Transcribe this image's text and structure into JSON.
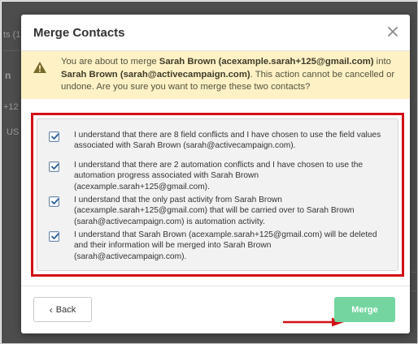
{
  "background": {
    "fragments": [
      "ts (1",
      "n",
      "+12",
      "US"
    ]
  },
  "modal": {
    "title": "Merge Contacts",
    "warning": {
      "prefix": "You are about to merge ",
      "contact_a": "Sarah Brown (acexample.sarah+125@gmail.com)",
      "middle": " into ",
      "contact_b": "Sarah Brown (sarah@activecampaign.com)",
      "suffix": ". This action cannot be cancelled or undone. Are you sure you want to merge these two contacts?"
    },
    "confirmations": [
      {
        "checked": true,
        "text": "I understand that there are 8 field conflicts and I have chosen to use the field values associated with Sarah Brown (sarah@activecampaign.com)."
      },
      {
        "checked": true,
        "text": "I understand that there are 2 automation conflicts and I have chosen to use the automation progress associated with Sarah Brown (acexample.sarah+125@gmail.com)."
      },
      {
        "checked": true,
        "text": "I understand that the only past activity from Sarah Brown (acexample.sarah+125@gmail.com) that will be carried over to Sarah Brown (sarah@activecampaign.com) is automation activity."
      },
      {
        "checked": true,
        "text": "I understand that Sarah Brown (acexample.sarah+125@gmail.com) will be deleted and their information will be merged into Sarah Brown (sarah@activecampaign.com)."
      }
    ],
    "back_label": "Back",
    "merge_label": "Merge"
  },
  "colors": {
    "warning_bg": "#fdf1c5",
    "warning_icon": "#7a6a2a",
    "highlight_border": "#d20f16",
    "merge_button": "#74d5a0",
    "annotation_arrow": "#d20f16"
  },
  "icons": {
    "close": "close-icon",
    "warning": "warning-icon",
    "checkmark": "checkmark-icon",
    "back": "chevron-left-icon"
  }
}
